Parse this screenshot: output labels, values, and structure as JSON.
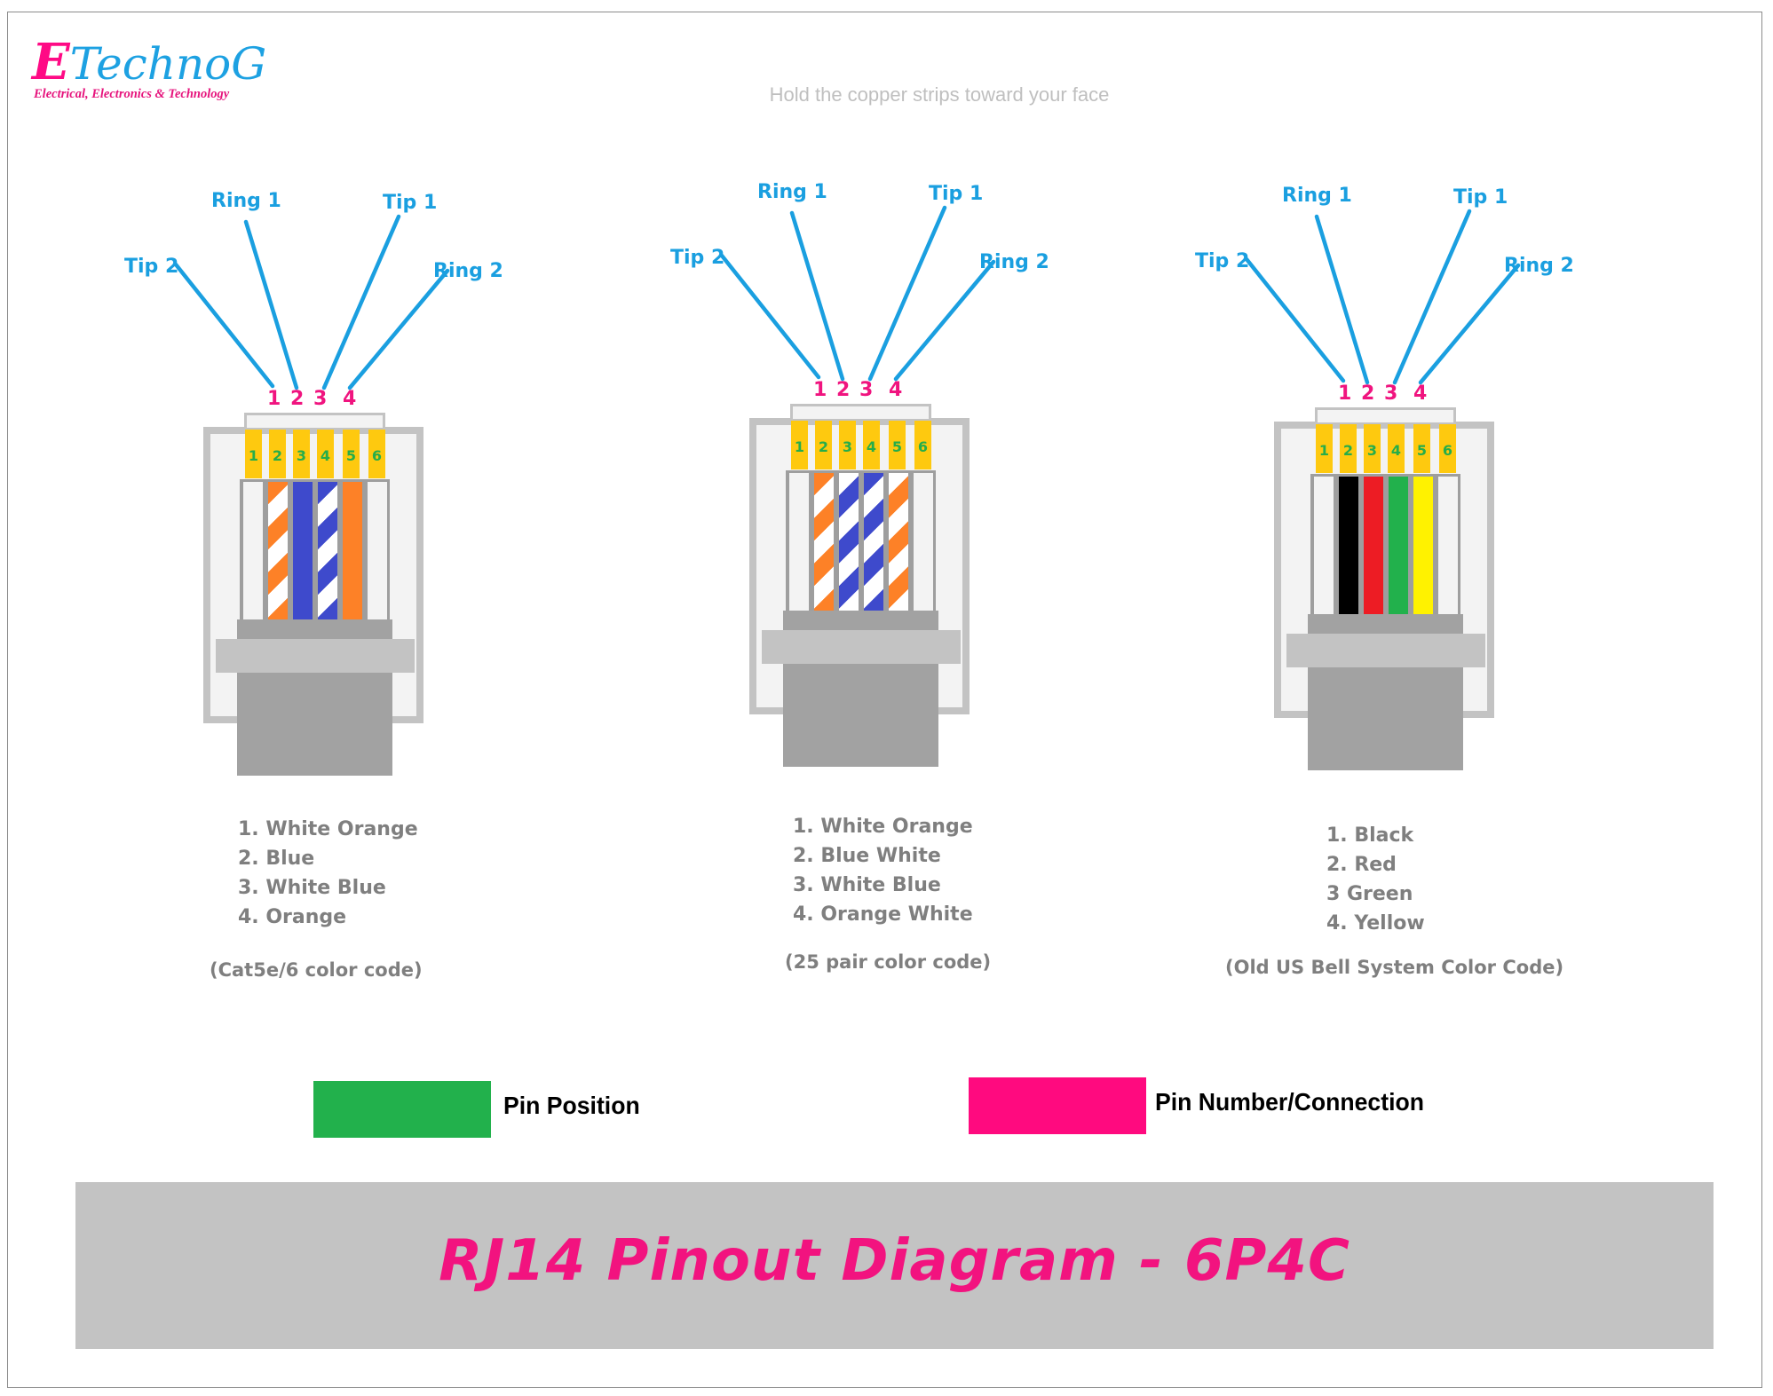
{
  "logo": {
    "brand_initial": "E",
    "brand_rest": "TechnoG",
    "tagline": "Electrical, Electronics & Technology"
  },
  "subtitle": "Hold the copper strips toward your face",
  "lead_labels": [
    "Tip 2",
    "Ring 1",
    "Tip 1",
    "Ring 2"
  ],
  "pin_numbers": [
    "1",
    "2",
    "3",
    "4"
  ],
  "contact_positions": [
    "1",
    "2",
    "3",
    "4",
    "5",
    "6"
  ],
  "colors": {
    "lead_line": "#1a9fe0",
    "pin_number": "#f0147f",
    "pin_position": "#26ad4a",
    "contact_gold": "#fec90f",
    "orange": "#fd8127",
    "blue": "#3e4acc",
    "white": "#ffffff",
    "black": "#000000",
    "red": "#ed1c24",
    "green": "#22b14c",
    "yellow": "#fff200"
  },
  "connectors": [
    {
      "id": "cat5e",
      "wires": [
        {
          "type": "stripe",
          "base": "#ffffff",
          "stripe": "#fd8127"
        },
        {
          "type": "solid",
          "base": "#3e4acc"
        },
        {
          "type": "stripe",
          "base": "#ffffff",
          "stripe": "#3e4acc"
        },
        {
          "type": "solid",
          "base": "#fd8127"
        }
      ],
      "color_list": [
        "1. White Orange",
        "2. Blue",
        "3. White Blue",
        "4. Orange"
      ],
      "caption": "(Cat5e/6 color code)"
    },
    {
      "id": "25pair",
      "wires": [
        {
          "type": "stripe",
          "base": "#ffffff",
          "stripe": "#fd8127"
        },
        {
          "type": "stripe",
          "base": "#3e4acc",
          "stripe": "#ffffff"
        },
        {
          "type": "stripe",
          "base": "#ffffff",
          "stripe": "#3e4acc"
        },
        {
          "type": "stripe",
          "base": "#fd8127",
          "stripe": "#ffffff"
        }
      ],
      "color_list": [
        "1. White Orange",
        "2. Blue White",
        "3. White Blue",
        "4. Orange White"
      ],
      "caption": "(25 pair color code)"
    },
    {
      "id": "usbell",
      "wires": [
        {
          "type": "solid",
          "base": "#000000"
        },
        {
          "type": "solid",
          "base": "#ed1c24"
        },
        {
          "type": "solid",
          "base": "#22b14c"
        },
        {
          "type": "solid",
          "base": "#fff200"
        }
      ],
      "color_list": [
        "1. Black",
        "2. Red",
        "3 Green",
        "4. Yellow"
      ],
      "caption": "(Old US Bell System Color Code)"
    }
  ],
  "legend": [
    {
      "label": "Pin Position",
      "color": "#22b14c"
    },
    {
      "label": "Pin Number/Connection",
      "color": "#ff0a7f"
    }
  ],
  "title": "RJ14 Pinout Diagram - 6P4C"
}
